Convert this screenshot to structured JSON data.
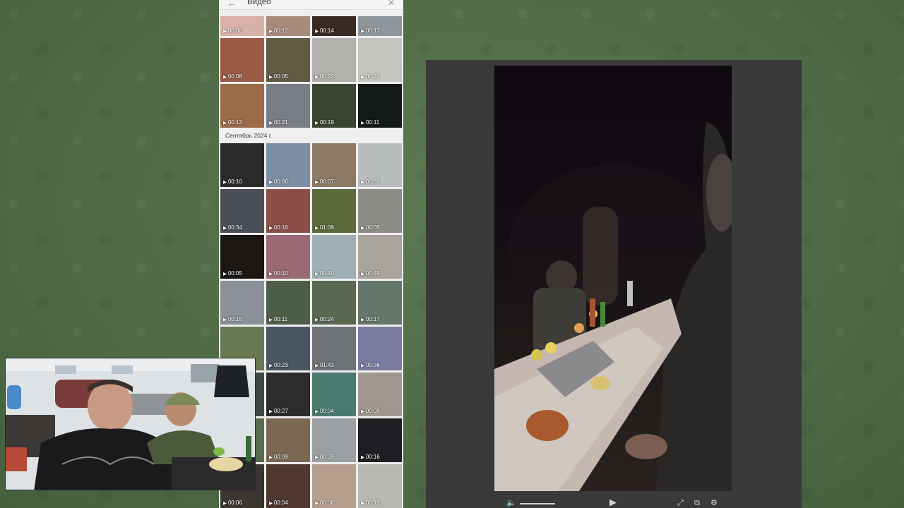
{
  "media_panel": {
    "title": "Видео",
    "month_label": "Сентябрь 2024 г.",
    "group_a": [
      {
        "duration": "00:08",
        "color": "#d8b2a8"
      },
      {
        "duration": "00:12",
        "color": "#a88a7c"
      },
      {
        "duration": "00:14",
        "color": "#3a2a24"
      },
      {
        "duration": "00:17",
        "color": "#8f969c"
      },
      {
        "duration": "00:08",
        "color": "#9a5a46"
      },
      {
        "duration": "00:05",
        "color": "#5e5a44"
      },
      {
        "duration": "00:22",
        "color": "#b3b1ad"
      },
      {
        "duration": "00:24",
        "color": "#c7c5c2"
      },
      {
        "duration": "00:12",
        "color": "#9c6b48"
      },
      {
        "duration": "00:21",
        "color": "#7b7d84"
      },
      {
        "duration": "00:19",
        "color": "#3b4532"
      },
      {
        "duration": "00:11",
        "color": "#151915"
      }
    ],
    "group_b": [
      {
        "duration": "00:10",
        "color": "#2a2a2a"
      },
      {
        "duration": "00:06",
        "color": "#7c8fa3"
      },
      {
        "duration": "00:07",
        "color": "#8c7a66"
      },
      {
        "duration": "00:50",
        "color": "#b9bdbd"
      },
      {
        "duration": "00:34",
        "color": "#4c4e58"
      },
      {
        "duration": "00:16",
        "color": "#8c4f48"
      },
      {
        "duration": "01:09",
        "color": "#5c6a3c"
      },
      {
        "duration": "00:05",
        "color": "#8e8e88"
      },
      {
        "duration": "00:05",
        "color": "#1a1614"
      },
      {
        "duration": "00:10",
        "color": "#9a6a76"
      },
      {
        "duration": "00:19",
        "color": "#9fb0b4"
      },
      {
        "duration": "00:49",
        "color": "#a9a49c"
      },
      {
        "duration": "00:18",
        "color": "#8b9196"
      },
      {
        "duration": "00:11",
        "color": "#4c5e48"
      },
      {
        "duration": "00:24",
        "color": "#5a6852"
      },
      {
        "duration": "00:17",
        "color": "#65766a"
      },
      {
        "duration": "",
        "color": "#6a7852"
      },
      {
        "duration": "00:23",
        "color": "#4a5660"
      },
      {
        "duration": "01:43",
        "color": "#6e7276"
      },
      {
        "duration": "00:36",
        "color": "#7b7aa0"
      },
      {
        "duration": "",
        "color": "#3a4a40"
      },
      {
        "duration": "00:27",
        "color": "#2c2c2c"
      },
      {
        "duration": "00:04",
        "color": "#4a7a6e"
      },
      {
        "duration": "00:08",
        "color": "#a2978e"
      },
      {
        "duration": "",
        "color": "#5a6a50"
      },
      {
        "duration": "00:09",
        "color": "#7a6852"
      },
      {
        "duration": "00:09",
        "color": "#9ca0a2"
      },
      {
        "duration": "00:16",
        "color": "#1e1e22"
      },
      {
        "duration": "00:06",
        "color": "#3a3630"
      },
      {
        "duration": "00:04",
        "color": "#4e3830"
      },
      {
        "duration": "00:06",
        "color": "#b59e8e"
      },
      {
        "duration": "00:19",
        "color": "#b8b8b4"
      }
    ]
  },
  "viewer": {
    "controls": {
      "volume_icon": "speaker-icon",
      "play_icon": "play-icon",
      "fullscreen_icon": "expand-icon",
      "pip_icon": "picture-in-picture-icon",
      "settings_icon": "gear-icon"
    }
  }
}
